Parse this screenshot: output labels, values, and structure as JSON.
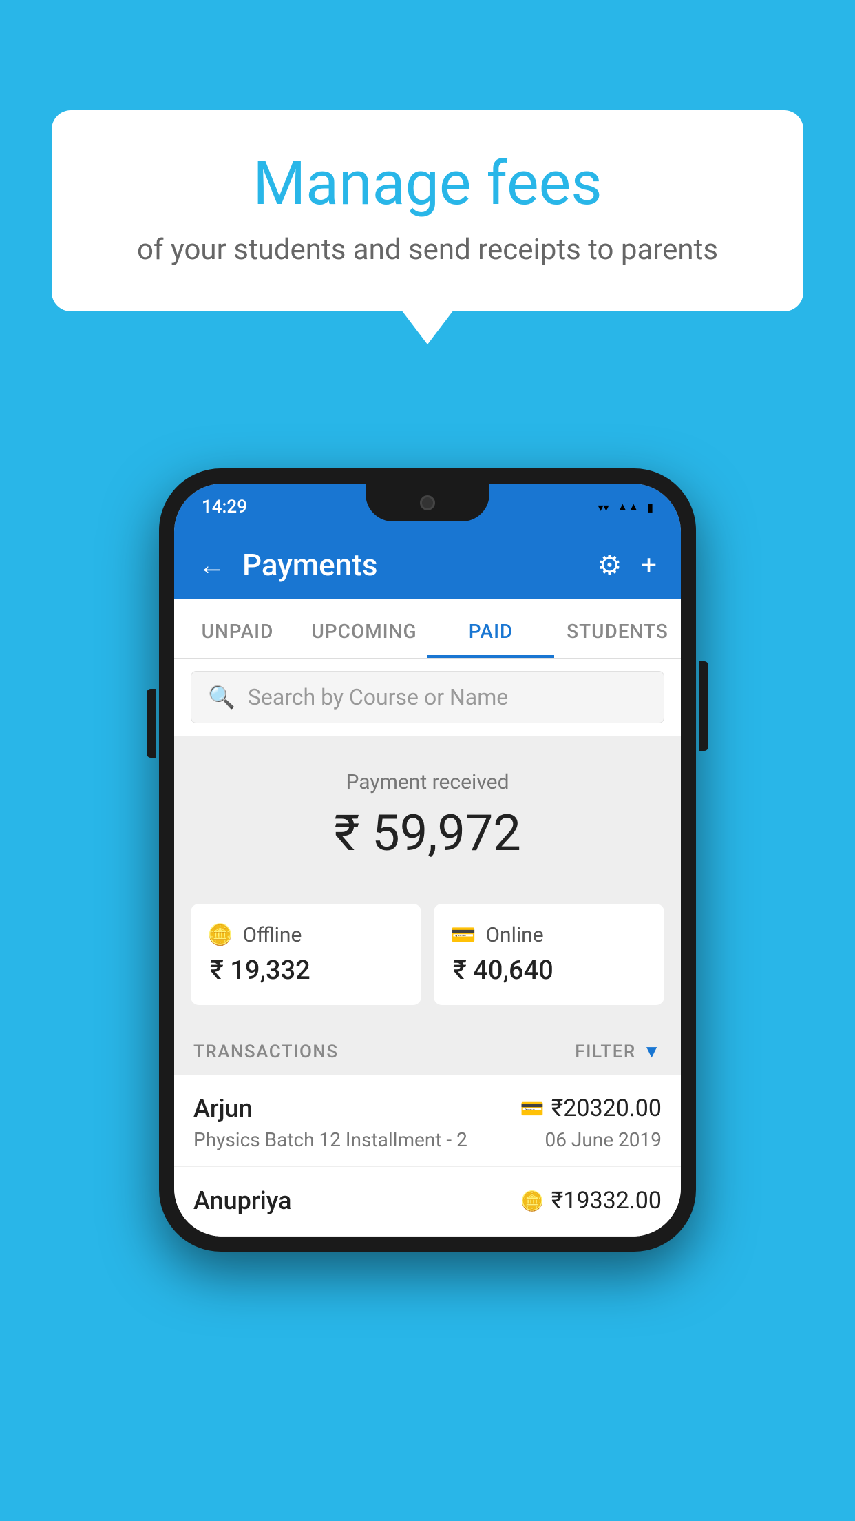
{
  "background_color": "#29b6e8",
  "bubble": {
    "title": "Manage fees",
    "subtitle": "of your students and send receipts to parents"
  },
  "phone": {
    "status_bar": {
      "time": "14:29",
      "icons": [
        "wifi",
        "signal",
        "battery"
      ]
    },
    "app_bar": {
      "title": "Payments",
      "back_label": "←",
      "settings_label": "⚙",
      "add_label": "+"
    },
    "tabs": [
      {
        "label": "UNPAID",
        "active": false
      },
      {
        "label": "UPCOMING",
        "active": false
      },
      {
        "label": "PAID",
        "active": true
      },
      {
        "label": "STUDENTS",
        "active": false
      }
    ],
    "search": {
      "placeholder": "Search by Course or Name"
    },
    "payment_summary": {
      "label": "Payment received",
      "amount": "₹ 59,972",
      "offline": {
        "label": "Offline",
        "amount": "₹ 19,332"
      },
      "online": {
        "label": "Online",
        "amount": "₹ 40,640"
      }
    },
    "transactions": {
      "header_label": "TRANSACTIONS",
      "filter_label": "FILTER",
      "items": [
        {
          "name": "Arjun",
          "course": "Physics Batch 12 Installment - 2",
          "amount": "₹20320.00",
          "date": "06 June 2019",
          "payment_type": "online"
        },
        {
          "name": "Anupriya",
          "course": "",
          "amount": "₹19332.00",
          "date": "",
          "payment_type": "offline"
        }
      ]
    }
  }
}
